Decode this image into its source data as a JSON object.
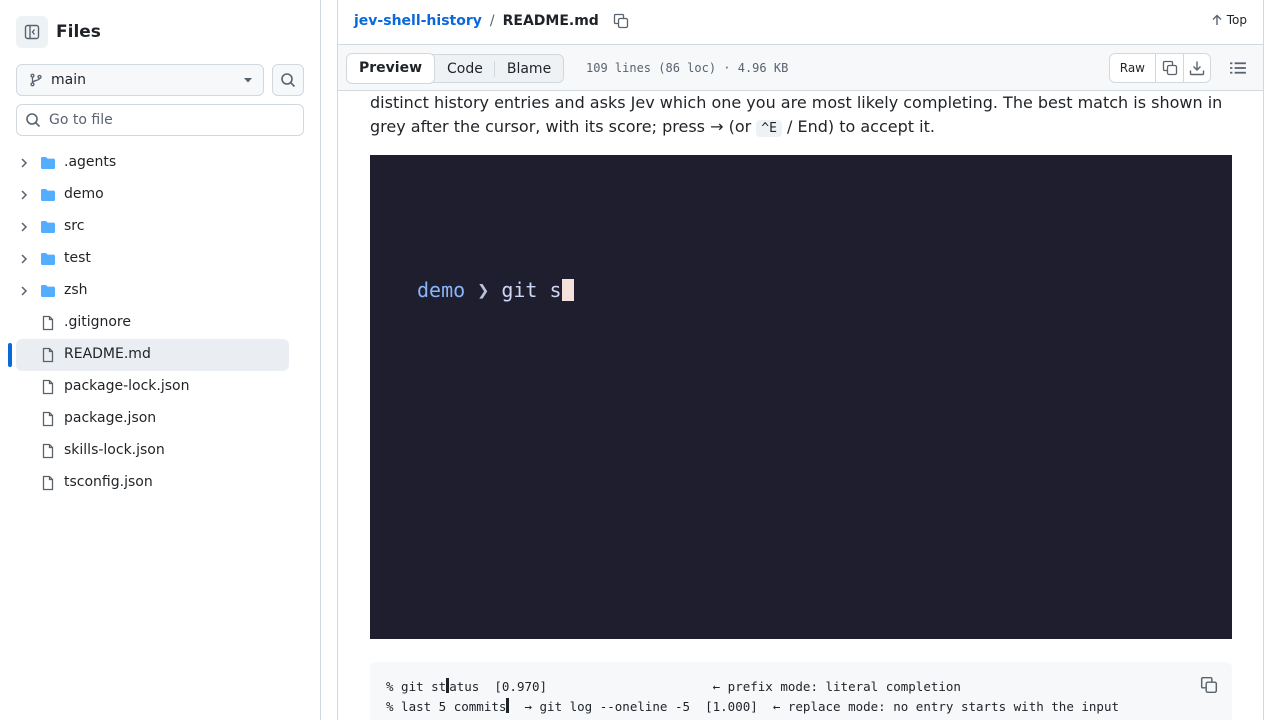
{
  "sidebar": {
    "title": "Files",
    "branch": "main",
    "search_placeholder": "Go to file",
    "items": [
      {
        "name": ".agents",
        "type": "folder"
      },
      {
        "name": "demo",
        "type": "folder"
      },
      {
        "name": "src",
        "type": "folder"
      },
      {
        "name": "test",
        "type": "folder"
      },
      {
        "name": "zsh",
        "type": "folder"
      },
      {
        "name": ".gitignore",
        "type": "file"
      },
      {
        "name": "README.md",
        "type": "file",
        "active": true
      },
      {
        "name": "package-lock.json",
        "type": "file"
      },
      {
        "name": "package.json",
        "type": "file"
      },
      {
        "name": "skills-lock.json",
        "type": "file"
      },
      {
        "name": "tsconfig.json",
        "type": "file"
      }
    ]
  },
  "header": {
    "repo": "jev-shell-history",
    "separator": "/",
    "file": "README.md",
    "top_label": "Top"
  },
  "toolbar": {
    "tabs": [
      "Preview",
      "Code",
      "Blame"
    ],
    "active_tab": "Preview",
    "meta": "109 lines (86 loc) · 4.96 KB",
    "raw_label": "Raw"
  },
  "content": {
    "para_line1": "distinct history entries and asks Jev which one you are most likely completing. The best match is shown in",
    "para_line2_a": "grey after the cursor, with its score; press → (or ",
    "para_kbd": "^E",
    "para_line2_b": " / End) to accept it.",
    "terminal": {
      "prompt": "demo",
      "arrow": "❯",
      "typed": "git s"
    },
    "code": {
      "line1_a": "% git st",
      "line1_b": "atus  [0.970]                      ← prefix mode: literal completion",
      "line2_a": "% last 5 commits",
      "line2_b": "  → git log --oneline -5  [1.000]  ← replace mode: no entry starts with the input"
    }
  },
  "icons": {
    "folder_color": "#54aeff",
    "accent": "#0969da"
  }
}
